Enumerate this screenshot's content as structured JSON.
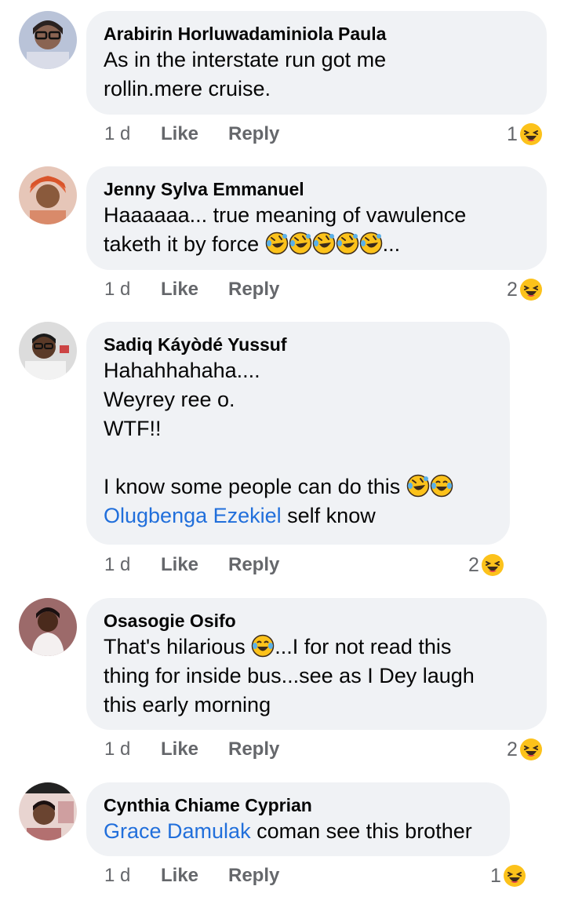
{
  "comments": [
    {
      "author": "Arabirin Horluwadaminiola Paula",
      "text_lines": [
        "As in the interstate run got me",
        "rollin.mere cruise."
      ],
      "time": "1 d",
      "like": "Like",
      "reply": "Reply",
      "reaction_count": "1",
      "reaction_icon": "laughing-face-icon"
    },
    {
      "author": "Jenny Sylva Emmanuel",
      "text_line1": "Haaaaaa... true meaning of vawulence",
      "text_line2": "taketh it by force",
      "text_line2_suffix": "...",
      "time": "1 d",
      "like": "Like",
      "reply": "Reply",
      "reaction_count": "2",
      "reaction_icon": "laughing-face-icon"
    },
    {
      "author": "Sadiq Káyòdé Yussuf",
      "text_lines": [
        "Hahahhahaha....",
        "Weyrey ree o.",
        "WTF!!",
        "",
        "I know some people can do this"
      ],
      "mention": "Olugbenga Ezekiel",
      "mention_suffix": " self know",
      "time": "1 d",
      "like": "Like",
      "reply": "Reply",
      "reaction_count": "2",
      "reaction_icon": "laughing-face-icon"
    },
    {
      "author": "Osasogie Osifo",
      "text_line1_prefix": "That's hilarious ",
      "text_line1_suffix": "...I for not read this",
      "text_line2": "thing for inside bus...see as I Dey laugh",
      "text_line3": "this early morning",
      "time": "1 d",
      "like": "Like",
      "reply": "Reply",
      "reaction_count": "2",
      "reaction_icon": "laughing-face-icon"
    },
    {
      "author": "Cynthia Chiame Cyprian",
      "mention": "Grace Damulak",
      "mention_suffix": " coman see this brother",
      "time": "1 d",
      "like": "Like",
      "reply": "Reply",
      "reaction_count": "1",
      "reaction_icon": "laughing-face-icon"
    }
  ],
  "colors": {
    "bubble": "#f0f2f5",
    "mention": "#216fdb",
    "meta": "#65676b",
    "emoji_face": "#fcc21b"
  }
}
